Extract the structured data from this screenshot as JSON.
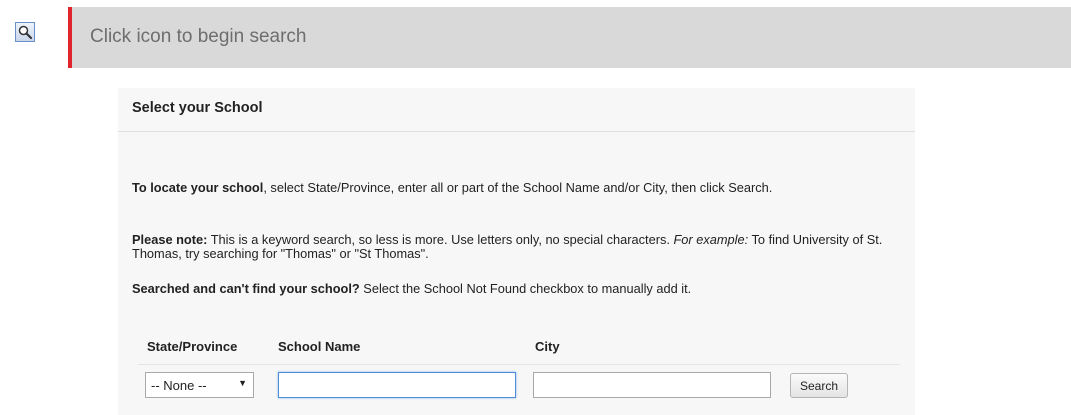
{
  "search_bar": {
    "icon": "magnifier-icon",
    "prompt": "Click icon to begin search"
  },
  "panel": {
    "title": "Select your School",
    "para1": {
      "bold": "To locate your school",
      "rest": ", select State/Province, enter all or part of the School Name and/or City, then click Search."
    },
    "para2": {
      "bold": "Please note:",
      "text1": " This is a keyword search, so less is more. Use letters only, no special characters. ",
      "italic": "For example:",
      "text2": " To find University of St. Thomas, try searching for \"Thomas\" or \"St Thomas\"."
    },
    "para3": {
      "bold": "Searched and can't find your school?",
      "rest": " Select the School Not Found checkbox to manually add it."
    }
  },
  "form": {
    "headers": {
      "state": "State/Province",
      "school": "School Name",
      "city": "City"
    },
    "state_select": {
      "selected": "-- None --",
      "arrow": "▼"
    },
    "school_name_value": "",
    "city_value": "",
    "search_button": "Search"
  },
  "colors": {
    "accent_bar": "#e0242c",
    "search_bar_bg": "#d9d9d9",
    "panel_bg": "#f7f7f7"
  }
}
